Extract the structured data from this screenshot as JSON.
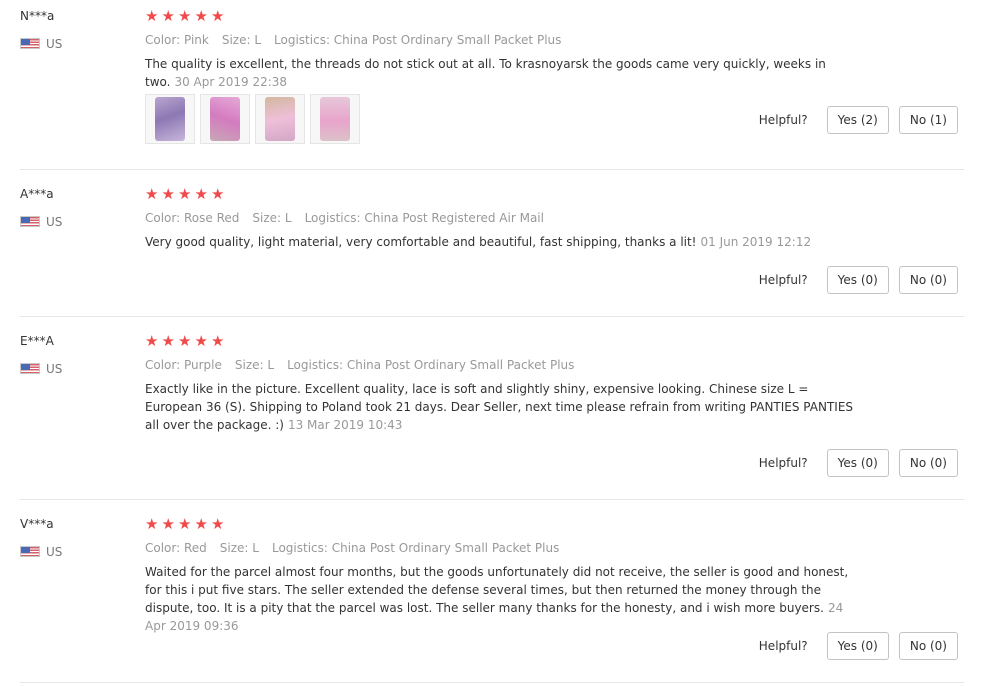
{
  "helpful_label": "Helpful?",
  "star_glyph": "★",
  "colors": {
    "star": "#f04b4b",
    "meta_text": "#999999",
    "body_text": "#333333",
    "divider": "#e6e6e6"
  },
  "reviews": [
    {
      "user": "N***a",
      "country": "US",
      "rating": 5,
      "color": "Color: Pink",
      "size": "Size: L",
      "logistics": "Logistics: China Post Ordinary Small Packet Plus",
      "text": "The quality is excellent, the threads do not stick out at all. To krasnoyarsk the goods came very quickly, weeks in two.",
      "date": "30 Apr 2019 22:38",
      "photos": [
        "product-photo",
        "product-photo",
        "product-photo",
        "product-photo"
      ],
      "yes": "Yes (2)",
      "no": "No (1)"
    },
    {
      "user": "A***a",
      "country": "US",
      "rating": 5,
      "color": "Color: Rose Red",
      "size": "Size: L",
      "logistics": "Logistics: China Post Registered Air Mail",
      "text": "Very good quality, light material, very comfortable and beautiful, fast shipping, thanks a lit!",
      "date": "01 Jun 2019 12:12",
      "yes": "Yes (0)",
      "no": "No (0)"
    },
    {
      "user": "E***A",
      "country": "US",
      "rating": 5,
      "color": "Color: Purple",
      "size": "Size: L",
      "logistics": "Logistics: China Post Ordinary Small Packet Plus",
      "text": "Exactly like in the picture. Excellent quality, lace is soft and slightly shiny, expensive looking. Chinese size L = European 36 (S). Shipping to Poland took 21 days. Dear Seller, next time please refrain from writing PANTIES PANTIES all over the package. :)",
      "date": "13 Mar 2019 10:43",
      "yes": "Yes (0)",
      "no": "No (0)"
    },
    {
      "user": "V***a",
      "country": "US",
      "rating": 5,
      "color": "Color: Red",
      "size": "Size: L",
      "logistics": "Logistics: China Post Ordinary Small Packet Plus",
      "text": "Waited for the parcel almost four months, but the goods unfortunately did not receive, the seller is good and honest, for this i put five stars. The seller extended the defense several times, but then returned the money through the dispute, too. It is a pity that the parcel was lost. The seller many thanks for the honesty, and i wish more buyers.",
      "date": "24 Apr 2019 09:36",
      "yes": "Yes (0)",
      "no": "No (0)"
    }
  ]
}
